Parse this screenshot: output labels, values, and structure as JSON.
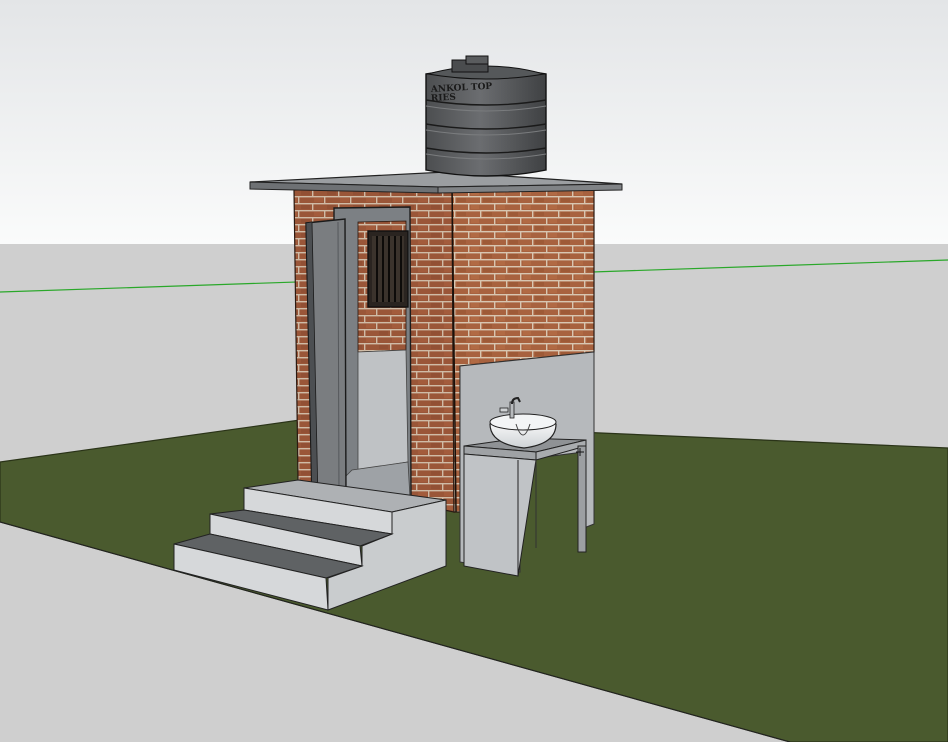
{
  "scene": {
    "colors": {
      "sky_top": "#e6e8ea",
      "sky_bottom": "#f9fafa",
      "ground": "#cfcfcf",
      "grass": "#4a5a2e",
      "brick": "#9c5a3c",
      "mortar": "#d9c9b6",
      "concrete": "#b9bcbf",
      "tank": "#5a5c5e",
      "horizon_line": "#2bb02b"
    },
    "tank_label_line1": "ANKOL TOP",
    "tank_label_line2": "RIES"
  }
}
